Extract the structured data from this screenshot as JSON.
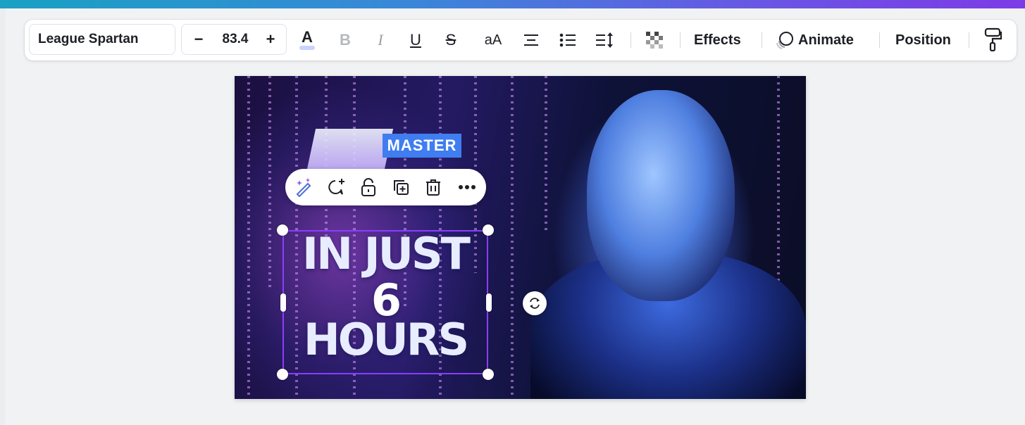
{
  "toolbar": {
    "font_family": "League Spartan",
    "font_size": "83.4",
    "minus_label": "−",
    "plus_label": "+",
    "text_color_glyph": "A",
    "bold_glyph": "B",
    "italic_glyph": "I",
    "underline_glyph": "U",
    "strike_glyph": "S",
    "case_glyph": "aA",
    "effects_label": "Effects",
    "animate_label": "Animate",
    "position_label": "Position"
  },
  "icons": {
    "align": "align-center-icon",
    "list": "bulleted-list-icon",
    "spacing": "line-spacing-icon",
    "transparency": "transparency-checker-icon",
    "animate": "animate-icon",
    "paint": "copy-style-paint-roller-icon",
    "ai_edit": "magic-edit-icon",
    "comment": "add-comment-icon",
    "lock": "lock-icon",
    "duplicate": "duplicate-icon",
    "delete": "trash-icon",
    "more": "more-options-icon",
    "rotate": "rotate-icon"
  },
  "design": {
    "logo_text": "MASTER",
    "headline_line1": "IN JUST",
    "headline_line2": "6",
    "headline_line3": "HOURS"
  },
  "colors": {
    "selection": "#8b3dff",
    "text_color_underline": "#c9d2ff"
  }
}
